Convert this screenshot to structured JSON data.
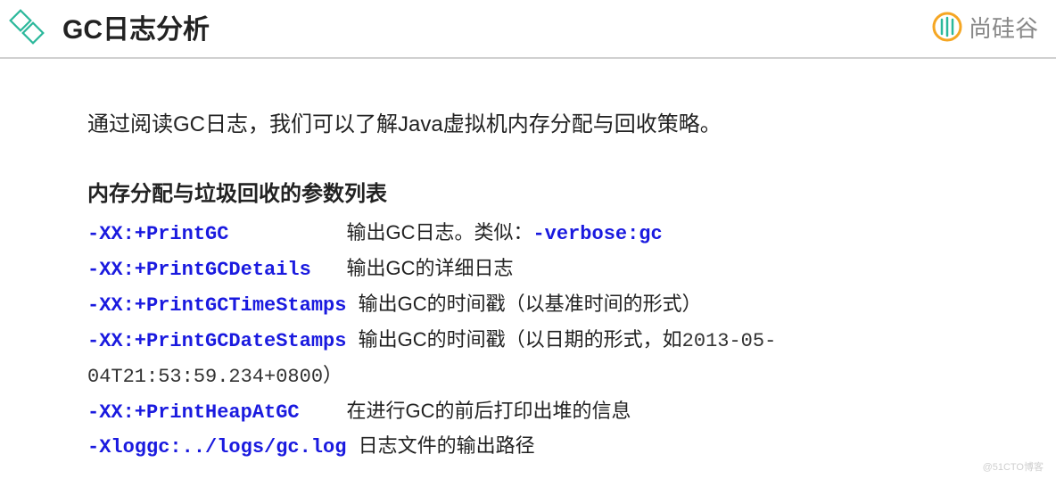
{
  "header": {
    "title": "GC日志分析",
    "brand_text": "尚硅谷"
  },
  "content": {
    "intro": "通过阅读GC日志，我们可以了解Java虚拟机内存分配与回收策略。",
    "subtitle": "内存分配与垃圾回收的参数列表",
    "params": {
      "p1_cmd": "-XX:+PrintGC",
      "p1_pad": "          ",
      "p1_desc_a": "输出GC日志。类似：",
      "p1_desc_b": "-verbose:gc",
      "p2_cmd": "-XX:+PrintGCDetails",
      "p2_pad": "   ",
      "p2_desc": "输出GC的详细日志",
      "p3_cmd": "-XX:+PrintGCTimeStamps",
      "p3_pad": " ",
      "p3_desc": "输出GC的时间戳（以基准时间的形式）",
      "p4_cmd": "-XX:+PrintGCDateStamps",
      "p4_pad": " ",
      "p4_desc_a": "输出GC的时间戳（以日期的形式，如",
      "p4_date_a": "2013-05-",
      "p4_date_b": "04T21:53:59.234+0800",
      "p4_desc_b": "）",
      "p5_cmd": "-XX:+PrintHeapAtGC",
      "p5_pad": "    ",
      "p5_desc": "在进行GC的前后打印出堆的信息",
      "p6_cmd": "-Xloggc:../logs/gc.log",
      "p6_pad": " ",
      "p6_desc": "日志文件的输出路径"
    }
  },
  "watermark": "@51CTO博客"
}
